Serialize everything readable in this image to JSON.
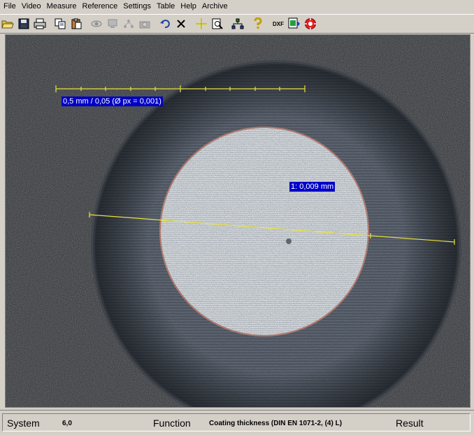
{
  "menu": {
    "items": [
      {
        "label": "File"
      },
      {
        "label": "Video"
      },
      {
        "label": "Measure"
      },
      {
        "label": "Reference"
      },
      {
        "label": "Settings"
      },
      {
        "label": "Table"
      },
      {
        "label": "Help"
      },
      {
        "label": "Archive"
      }
    ]
  },
  "toolbar": {
    "buttons": [
      {
        "icon": "open-folder-icon"
      },
      {
        "icon": "save-disk-icon"
      },
      {
        "icon": "print-icon"
      },
      {
        "icon": "copy-icon"
      },
      {
        "icon": "paste-icon"
      },
      {
        "icon": "eye-icon"
      },
      {
        "icon": "monitor-icon"
      },
      {
        "icon": "tree-icon"
      },
      {
        "icon": "camera-icon"
      },
      {
        "icon": "undo-icon"
      },
      {
        "icon": "delete-x-icon"
      },
      {
        "icon": "crosshair-icon"
      },
      {
        "icon": "zoom-page-icon"
      },
      {
        "icon": "network-icon"
      },
      {
        "icon": "help-icon"
      },
      {
        "icon": "dxf-export-icon"
      },
      {
        "icon": "excel-export-icon"
      },
      {
        "icon": "stop-icon"
      }
    ],
    "dxf_label": "DXF"
  },
  "image": {
    "scale_label": "0,5 mm / 0,05 (Ø px = 0,001)",
    "measurement_label": "1: 0,009 mm"
  },
  "status": {
    "system_label": "System",
    "system_value": "6,0",
    "function_label": "Function",
    "function_value": "Coating thickness (DIN EN 1071-2, (4) L)",
    "result_label": "Result"
  },
  "colors": {
    "label_bg": "#0000c8",
    "measure_line": "#e8e040",
    "chrome": "#d4d0c8"
  }
}
